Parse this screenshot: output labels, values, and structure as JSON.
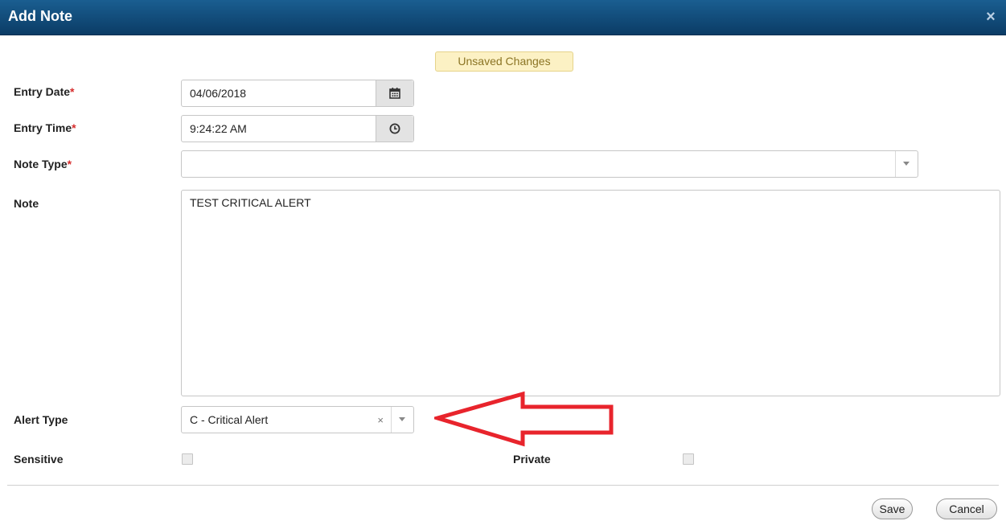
{
  "dialog": {
    "title": "Add Note",
    "close_symbol": "×"
  },
  "status_badge": "Unsaved Changes",
  "fields": {
    "entry_date": {
      "label": "Entry Date",
      "required_marker": "*",
      "value": "04/06/2018",
      "addon_icon": "calendar-icon"
    },
    "entry_time": {
      "label": "Entry Time",
      "required_marker": "*",
      "value": "9:24:22 AM",
      "addon_icon": "clock-icon"
    },
    "note_type": {
      "label": "Note Type",
      "required_marker": "*",
      "value": ""
    },
    "note": {
      "label": "Note",
      "value": "TEST CRITICAL ALERT"
    },
    "alert_type": {
      "label": "Alert Type",
      "value": "C - Critical Alert",
      "clear_symbol": "×"
    },
    "sensitive": {
      "label": "Sensitive",
      "checked": false
    },
    "private": {
      "label": "Private",
      "checked": false
    }
  },
  "buttons": {
    "save": "Save",
    "cancel": "Cancel"
  },
  "annotation": {
    "arrow_color": "#e8242c",
    "points_to": "alert_type"
  },
  "colors": {
    "title_bar": "#0d4675",
    "required": "#d62d2d",
    "badge_bg": "#fcf1c4"
  }
}
